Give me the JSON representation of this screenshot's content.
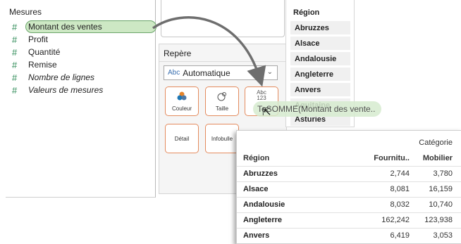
{
  "data_pane": {
    "header": "Mesures",
    "measures": [
      {
        "label": "Montant des ventes",
        "icon": "hash-icon",
        "selected": true
      },
      {
        "label": "Profit",
        "icon": "hash-icon"
      },
      {
        "label": "Quantité",
        "icon": "hash-icon"
      },
      {
        "label": "Remise",
        "icon": "hash-icon"
      },
      {
        "label": "Nombre de lignes",
        "icon": "hash-icon",
        "italic": true
      },
      {
        "label": "Valeurs de mesures",
        "icon": "hash-icon",
        "italic": true
      }
    ]
  },
  "marks": {
    "title": "Repère",
    "mark_type_abc": "Abc",
    "mark_type": "Automatique",
    "chevron": "⌄",
    "buttons": {
      "color": "Couleur",
      "size": "Taille",
      "text_icon": "Abc\n123",
      "detail": "Détail",
      "tooltip": "Infobulle"
    }
  },
  "region_list": {
    "header": "Région",
    "items": [
      "Abruzzes",
      "Alsace",
      "Andalousie",
      "Angleterre",
      "Anvers",
      "Aquitaine",
      "Asturies"
    ]
  },
  "drag": {
    "pill": "TeSOMME(Montant des vente.."
  },
  "table": {
    "category_label": "Catégorie",
    "columns": [
      "Région",
      "Fournitu..",
      "Mobilier"
    ],
    "rows": [
      [
        "Abruzzes",
        "2,744",
        "3,780"
      ],
      [
        "Alsace",
        "8,081",
        "16,159"
      ],
      [
        "Andalousie",
        "8,032",
        "10,740"
      ],
      [
        "Angleterre",
        "162,242",
        "123,938"
      ],
      [
        "Anvers",
        "6,419",
        "3,053"
      ]
    ]
  },
  "colors": {
    "measure_icon": "#2e8b57",
    "pill_fill": "#cde8c4",
    "pill_border": "#6aa56a",
    "mark_button_border": "#e48b5e",
    "arrow": "#6e6e6e"
  }
}
